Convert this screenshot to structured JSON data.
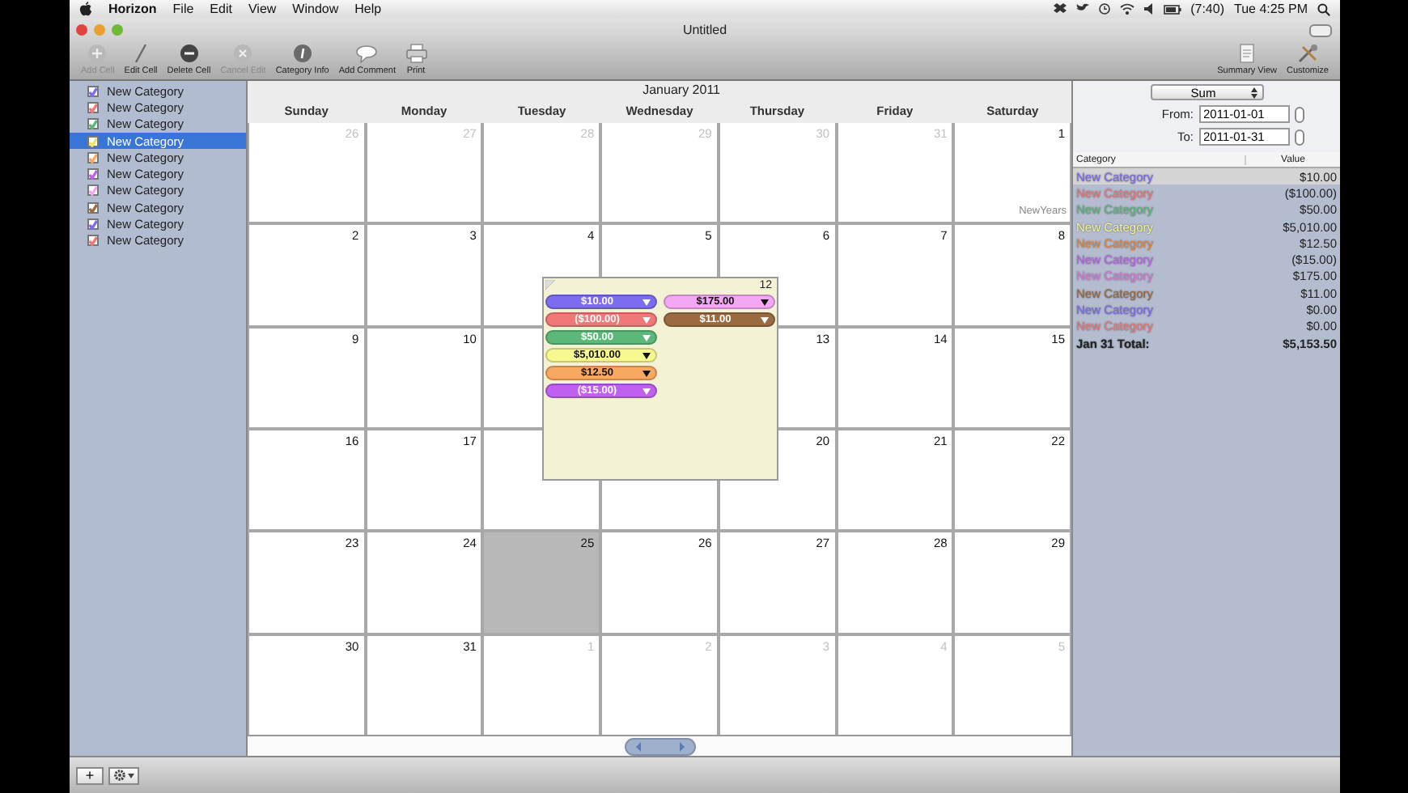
{
  "menu_bar": {
    "app": "Horizon",
    "items": [
      "File",
      "Edit",
      "View",
      "Window",
      "Help"
    ],
    "battery": "(7:40)",
    "clock": "Tue 4:25 PM"
  },
  "window": {
    "title": "Untitled"
  },
  "toolbar": [
    {
      "label": "Add Cell",
      "kind": "add",
      "disabled": true
    },
    {
      "label": "Edit Cell",
      "kind": "edit",
      "disabled": false
    },
    {
      "label": "Delete Cell",
      "kind": "delete",
      "disabled": false
    },
    {
      "label": "Cancel Edit",
      "kind": "cancel",
      "disabled": true
    },
    {
      "label": "Category Info",
      "kind": "info",
      "disabled": false
    },
    {
      "label": "Add Comment",
      "kind": "comment",
      "disabled": false
    },
    {
      "label": "Print",
      "kind": "print",
      "disabled": false
    }
  ],
  "toolbar_right": [
    {
      "label": "Summary View",
      "kind": "summary"
    },
    {
      "label": "Customize",
      "kind": "customize"
    }
  ],
  "sidebar": {
    "items": [
      {
        "label": "New Category",
        "color": "#7b6cf0",
        "checked": true,
        "selected": false
      },
      {
        "label": "New Category",
        "color": "#f07878",
        "checked": true,
        "selected": false
      },
      {
        "label": "New Category",
        "color": "#5cb878",
        "checked": true,
        "selected": false
      },
      {
        "label": "New Category",
        "color": "#f0e070",
        "checked": true,
        "selected": true
      },
      {
        "label": "New Category",
        "color": "#f8a860",
        "checked": true,
        "selected": false
      },
      {
        "label": "New Category",
        "color": "#c060f0",
        "checked": true,
        "selected": false
      },
      {
        "label": "New Category",
        "color": "#f4a8f4",
        "checked": true,
        "selected": false
      },
      {
        "label": "New Category",
        "color": "#9a6a40",
        "checked": true,
        "selected": false
      },
      {
        "label": "New Category",
        "color": "#7b6cf0",
        "checked": true,
        "selected": false
      },
      {
        "label": "New Category",
        "color": "#f07878",
        "checked": true,
        "selected": false
      }
    ]
  },
  "calendar": {
    "title": "January 2011",
    "weekdays": [
      "Sunday",
      "Monday",
      "Tuesday",
      "Wednesday",
      "Thursday",
      "Friday",
      "Saturday"
    ],
    "cells": [
      {
        "day": "26",
        "other_month": true,
        "selected": false
      },
      {
        "day": "27",
        "other_month": true,
        "selected": false
      },
      {
        "day": "28",
        "other_month": true,
        "selected": false
      },
      {
        "day": "29",
        "other_month": true,
        "selected": false
      },
      {
        "day": "30",
        "other_month": true,
        "selected": false
      },
      {
        "day": "31",
        "other_month": true,
        "selected": false
      },
      {
        "day": "1",
        "other_month": false,
        "selected": false,
        "note": "NewYears"
      },
      {
        "day": "2",
        "other_month": false,
        "selected": false
      },
      {
        "day": "3",
        "other_month": false,
        "selected": false
      },
      {
        "day": "4",
        "other_month": false,
        "selected": false
      },
      {
        "day": "5",
        "other_month": false,
        "selected": false
      },
      {
        "day": "6",
        "other_month": false,
        "selected": false
      },
      {
        "day": "7",
        "other_month": false,
        "selected": false
      },
      {
        "day": "8",
        "other_month": false,
        "selected": false
      },
      {
        "day": "9",
        "other_month": false,
        "selected": false
      },
      {
        "day": "10",
        "other_month": false,
        "selected": false
      },
      {
        "selected": false
      },
      null,
      {
        "day": "13",
        "other_month": false,
        "selected": false
      },
      {
        "day": "14",
        "other_month": false,
        "selected": false
      },
      {
        "day": "15",
        "other_month": false,
        "selected": false
      },
      {
        "day": "16",
        "other_month": false,
        "selected": false
      },
      {
        "day": "17",
        "other_month": false,
        "selected": false
      },
      {
        "selected": false
      },
      {
        "selected": false
      },
      {
        "day": "20",
        "other_month": false,
        "selected": false
      },
      {
        "day": "21",
        "other_month": false,
        "selected": false
      },
      {
        "day": "22",
        "other_month": false,
        "selected": false
      },
      {
        "day": "23",
        "other_month": false,
        "selected": false
      },
      {
        "day": "24",
        "other_month": false,
        "selected": false
      },
      {
        "day": "25",
        "other_month": false,
        "selected": true
      },
      {
        "day": "26",
        "other_month": false,
        "selected": false
      },
      {
        "day": "27",
        "other_month": false,
        "selected": false
      },
      {
        "day": "28",
        "other_month": false,
        "selected": false
      },
      {
        "day": "29",
        "other_month": false,
        "selected": false
      },
      {
        "day": "30",
        "other_month": false,
        "selected": false
      },
      {
        "day": "31",
        "other_month": false,
        "selected": false
      },
      {
        "day": "1",
        "other_month": true,
        "selected": false
      },
      {
        "day": "2",
        "other_month": true,
        "selected": false
      },
      {
        "day": "3",
        "other_month": true,
        "selected": false
      },
      {
        "day": "4",
        "other_month": true,
        "selected": false
      },
      {
        "day": "5",
        "other_month": true,
        "selected": false
      }
    ],
    "popup": {
      "day": "12",
      "columns": [
        [
          {
            "amount": "$10.00",
            "color": "#7b6cf0"
          },
          {
            "amount": "($100.00)",
            "color": "#f07878"
          },
          {
            "amount": "$50.00",
            "color": "#5cb878"
          },
          {
            "amount": "$5,010.00",
            "color": "#f8f890"
          },
          {
            "amount": "$12.50",
            "color": "#f8a860"
          },
          {
            "amount": "($15.00)",
            "color": "#c060f0"
          }
        ],
        [
          {
            "amount": "$175.00",
            "color": "#f4a8f4"
          },
          {
            "amount": "$11.00",
            "color": "#9a6a40"
          }
        ]
      ]
    }
  },
  "summary": {
    "mode": "Sum",
    "from_label": "From:",
    "from": "2011-01-01",
    "to_label": "To:",
    "to": "2011-01-31",
    "columns": [
      "Category",
      "Value"
    ],
    "rows": [
      {
        "category": "New Category",
        "value": "$10.00",
        "color": "#7b6cf0",
        "selected": true
      },
      {
        "category": "New Category",
        "value": "($100.00)",
        "color": "#f07878",
        "selected": false
      },
      {
        "category": "New Category",
        "value": "$50.00",
        "color": "#5cb878",
        "selected": false
      },
      {
        "category": "New Category",
        "value": "$5,010.00",
        "color": "#f8f890",
        "selected": false
      },
      {
        "category": "New Category",
        "value": "$12.50",
        "color": "#e8883a",
        "selected": false
      },
      {
        "category": "New Category",
        "value": "($15.00)",
        "color": "#c060f0",
        "selected": false
      },
      {
        "category": "New Category",
        "value": "$175.00",
        "color": "#dc78dc",
        "selected": false
      },
      {
        "category": "New Category",
        "value": "$11.00",
        "color": "#9a6a40",
        "selected": false
      },
      {
        "category": "New Category",
        "value": "$0.00",
        "color": "#7b6cf0",
        "selected": false
      },
      {
        "category": "New Category",
        "value": "$0.00",
        "color": "#f07878",
        "selected": false
      }
    ],
    "total": {
      "label": "Jan 31 Total:",
      "value": "$5,153.50"
    }
  },
  "bottom_bar": {
    "add_button": "+"
  }
}
